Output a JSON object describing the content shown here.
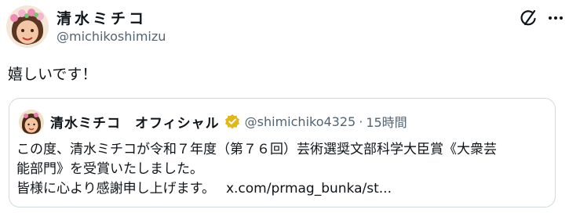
{
  "post": {
    "author_name": "清水ミチコ",
    "author_handle": "@michikoshimizu",
    "text": "嬉しいです！"
  },
  "quote": {
    "author_name": "清水ミチコ　オフィシャル",
    "author_handle": "@shimichiko4325",
    "separator": "·",
    "time": "15時間",
    "body_line1": "この度、清水ミチコが令和７年度（第７６回）芸術選奨文部科学大臣賞《大衆芸",
    "body_line2": "能部門》を受賞いたしました。",
    "body_line3": "皆様に心より感謝申し上げます。",
    "link": "x.com/prmag_bunka/st..."
  },
  "icons": {
    "grok": "grok-icon",
    "more": "more-icon",
    "verified": "verified-badge-icon"
  },
  "colors": {
    "text": "#0f1419",
    "secondary": "#536471",
    "border": "#cfd9de",
    "verified_gold": "#e2b719"
  }
}
